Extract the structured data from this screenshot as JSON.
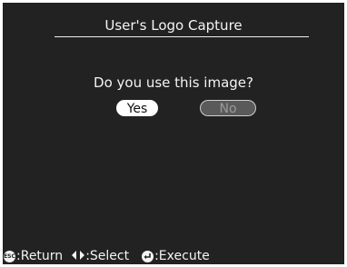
{
  "dialog": {
    "title": "User's Logo Capture",
    "question": "Do you use this image?",
    "buttons": {
      "yes_label": "Yes",
      "no_label": "No",
      "selected": "Yes"
    }
  },
  "footer": {
    "return_icon": "esc-icon",
    "return_label": ":Return",
    "select_icon": "left-right-arrows-icon",
    "select_label": ":Select",
    "execute_icon": "enter-icon",
    "execute_label": ":Execute"
  },
  "colors": {
    "background": "#222222",
    "text": "#f4f4f4",
    "selected_button_bg": "#ffffff",
    "unselected_button_bg": "#5a5a5a"
  }
}
